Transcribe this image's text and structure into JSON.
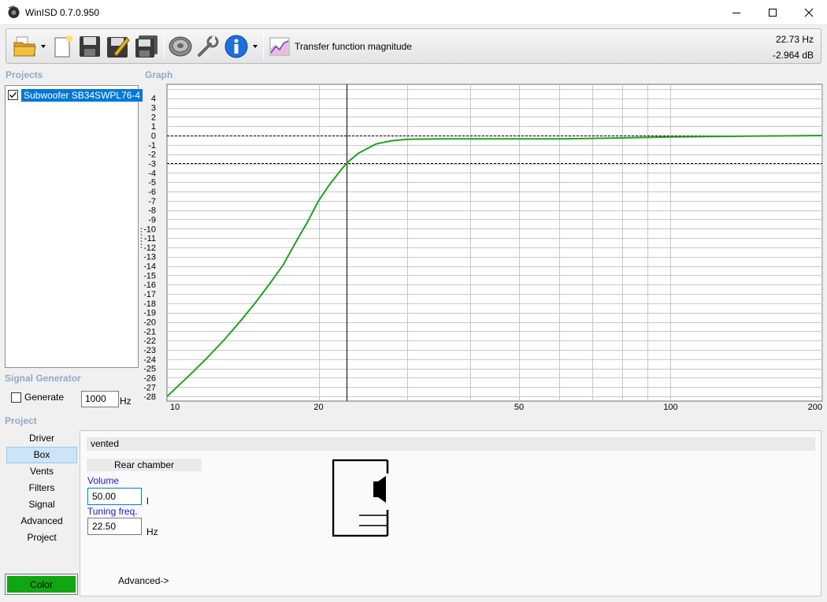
{
  "window": {
    "title": "WinISD 0.7.0.950"
  },
  "toolbar": {
    "icons": [
      "open-folder-icon",
      "new-document-icon",
      "save-icon",
      "save-as-icon",
      "save-all-icon",
      "driver-icon",
      "settings-wrench-icon",
      "info-icon",
      "transfer-function-icon"
    ],
    "graph_label": "Transfer function magnitude",
    "readout_freq": "22.73 Hz",
    "readout_db": "-2.964 dB"
  },
  "projects": {
    "title": "Projects",
    "items": [
      {
        "label": "Subwoofer SB34SWPL76-4",
        "checked": true
      }
    ]
  },
  "graph": {
    "title": "Graph",
    "y_ticks": [
      "4",
      "3",
      "2",
      "1",
      "0",
      "-1",
      "-2",
      "-3",
      "-4",
      "-5",
      "-6",
      "-7",
      "-8",
      "-9",
      "-10",
      "-11",
      "-12",
      "-13",
      "-14",
      "-15",
      "-16",
      "-17",
      "-18",
      "-19",
      "-20",
      "-21",
      "-22",
      "-23",
      "-24",
      "-25",
      "-26",
      "-27",
      "-28"
    ],
    "x_ticks": [
      "10",
      "20",
      "50",
      "100",
      "200"
    ],
    "cursor_freq_hz": 22.73,
    "cursor_db": -2.964,
    "curve_color": "#1fa31f"
  },
  "chart_data": {
    "type": "line",
    "x_scale": "log",
    "xlim": [
      10,
      200
    ],
    "ylim": [
      -28.5,
      5.5
    ],
    "series": [
      {
        "x": [
          10,
          11,
          12,
          13,
          14,
          15,
          16,
          17,
          18,
          19,
          20,
          21,
          22,
          22.73,
          24,
          26,
          28,
          30,
          35,
          40,
          50,
          60,
          70,
          80,
          90,
          100,
          120,
          150,
          200
        ],
        "y": [
          -28,
          -25.9,
          -23.9,
          -21.9,
          -19.9,
          -17.9,
          -15.9,
          -13.9,
          -11.5,
          -9.3,
          -7.0,
          -5.3,
          -3.9,
          -2.964,
          -1.9,
          -0.9,
          -0.55,
          -0.4,
          -0.35,
          -0.35,
          -0.35,
          -0.35,
          -0.3,
          -0.25,
          -0.2,
          -0.15,
          -0.1,
          -0.05,
          0
        ]
      }
    ]
  },
  "signal_generator": {
    "title": "Signal Generator",
    "generate_label": "Generate",
    "generate_checked": false,
    "frequency": "1000",
    "unit": "Hz"
  },
  "project": {
    "title": "Project",
    "nav": [
      "Driver",
      "Box",
      "Vents",
      "Filters",
      "Signal",
      "Advanced",
      "Project"
    ],
    "active_nav": "Box",
    "color_label": "Color",
    "color_value": "#10a610"
  },
  "box": {
    "type_label": "vented",
    "chamber_label": "Rear chamber",
    "volume_label": "Volume",
    "volume_value": "50.00",
    "volume_unit": "l",
    "tuning_label": "Tuning freq.",
    "tuning_value": "22.50",
    "tuning_unit": "Hz",
    "advanced_link": "Advanced->"
  }
}
